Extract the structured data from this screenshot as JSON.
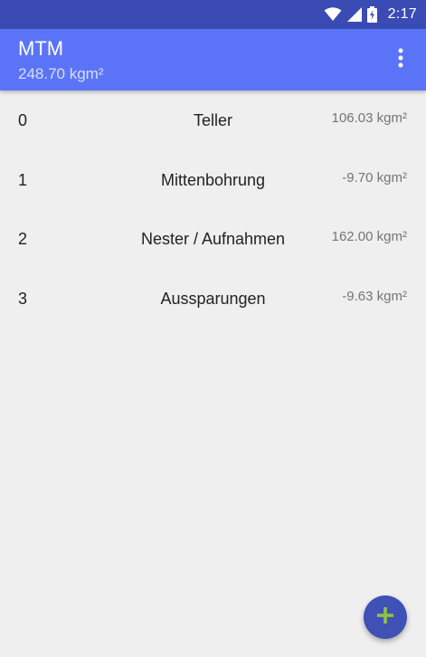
{
  "status_bar": {
    "time": "2:17",
    "icons": [
      "wifi-icon",
      "signal-icon",
      "battery-charging-icon"
    ]
  },
  "app_bar": {
    "title": "MTM",
    "subtitle": "248.70 kgm²",
    "menu_icon": "overflow-menu-icon"
  },
  "items": [
    {
      "index": "0",
      "name": "Teller",
      "value": "106.03 kgm²"
    },
    {
      "index": "1",
      "name": "Mittenbohrung",
      "value": "-9.70 kgm²"
    },
    {
      "index": "2",
      "name": "Nester / Aufnahmen",
      "value": "162.00 kgm²"
    },
    {
      "index": "3",
      "name": "Aussparungen",
      "value": "-9.63 kgm²"
    }
  ],
  "fab": {
    "icon": "plus-icon"
  },
  "colors": {
    "status_bar": "#3a4bb4",
    "app_bar": "#5b74f7",
    "background": "#efefef",
    "fab": "#3f51b5",
    "fab_icon": "#8bc34a"
  }
}
